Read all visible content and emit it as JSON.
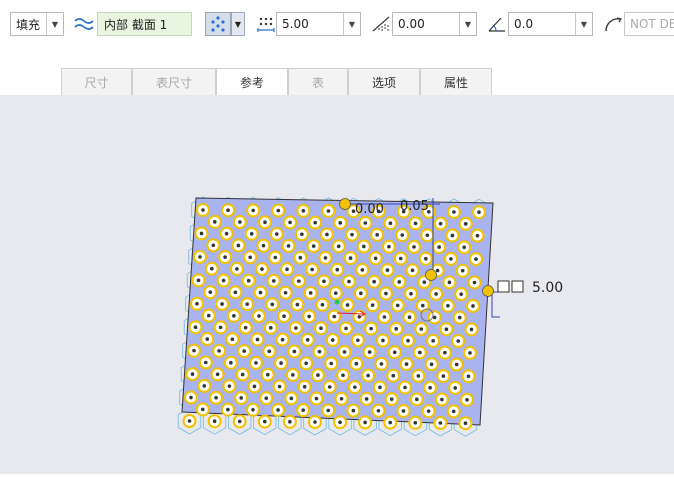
{
  "toolbar": {
    "fill_label": "填充",
    "section_label": "内部 截面 1",
    "spacing_value": "5.00",
    "offset_value": "0.00",
    "angle_value": "0.0",
    "round_value": "NOT DE",
    "icons": [
      "wave-section-icon",
      "pattern-points-icon",
      "spacing-icon",
      "hatch-offset-icon",
      "angle-icon",
      "round-arc-icon"
    ]
  },
  "tabs": [
    {
      "label": "尺寸",
      "enabled": false
    },
    {
      "label": "表尺寸",
      "enabled": false
    },
    {
      "label": "参考",
      "enabled": true,
      "active": true
    },
    {
      "label": "表",
      "enabled": false
    },
    {
      "label": "选项",
      "enabled": true
    },
    {
      "label": "属性",
      "enabled": true
    }
  ],
  "canvas": {
    "background": "#e8e9ee",
    "region_fill": "#a8b3f0",
    "hole_ring_color": "#f2c200",
    "hexagon_color": "#6fb8e6",
    "dim_top_a": "0.00",
    "dim_top_b": "0.05",
    "dim_right": "5.00"
  }
}
